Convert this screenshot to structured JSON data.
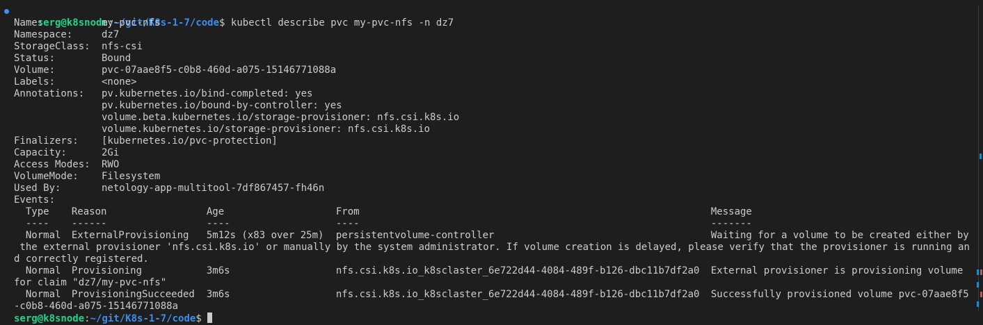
{
  "prompt": {
    "user_host": "serg@k8snode",
    "path": "~/git/K8s-1-7/code",
    "symbol": "$",
    "command": "kubectl describe pvc my-pvc-nfs -n dz7"
  },
  "fields": [
    {
      "key": "Name:",
      "value": "my-pvc-nfs"
    },
    {
      "key": "Namespace:",
      "value": "dz7"
    },
    {
      "key": "StorageClass:",
      "value": "nfs-csi"
    },
    {
      "key": "Status:",
      "value": "Bound"
    },
    {
      "key": "Volume:",
      "value": "pvc-07aae8f5-c0b8-460d-a075-15146771088a"
    },
    {
      "key": "Labels:",
      "value": "<none>"
    },
    {
      "key": "Annotations:",
      "value": "pv.kubernetes.io/bind-completed: yes"
    },
    {
      "key": "",
      "value": "pv.kubernetes.io/bound-by-controller: yes"
    },
    {
      "key": "",
      "value": "volume.beta.kubernetes.io/storage-provisioner: nfs.csi.k8s.io"
    },
    {
      "key": "",
      "value": "volume.kubernetes.io/storage-provisioner: nfs.csi.k8s.io"
    },
    {
      "key": "Finalizers:",
      "value": "[kubernetes.io/pvc-protection]"
    },
    {
      "key": "Capacity:",
      "value": "2Gi"
    },
    {
      "key": "Access Modes:",
      "value": "RWO"
    },
    {
      "key": "VolumeMode:",
      "value": "Filesystem"
    },
    {
      "key": "Used By:",
      "value": "netology-app-multitool-7df867457-fh46n"
    },
    {
      "key": "Events:",
      "value": ""
    }
  ],
  "events": {
    "headers": {
      "type": "Type",
      "reason": "Reason",
      "age": "Age",
      "from": "From",
      "message": "Message"
    },
    "dashes": {
      "type": "----",
      "reason": "------",
      "age": "----",
      "from": "----",
      "message": "-------"
    },
    "rows": [
      {
        "type": "Normal",
        "reason": "ExternalProvisioning",
        "age": "5m12s (x83 over 25m)",
        "from": "persistentvolume-controller",
        "message": "Waiting for a volume to be created either by",
        "wrap": [
          " the external provisioner 'nfs.csi.k8s.io' or manually by the system administrator. If volume creation is delayed, please verify that the provisioner is running an",
          "d correctly registered."
        ]
      },
      {
        "type": "Normal",
        "reason": "Provisioning",
        "age": "3m6s",
        "from": "nfs.csi.k8s.io_k8sclaster_6e722d44-4084-489f-b126-dbc11b7df2a0",
        "message": "External provisioner is provisioning volume",
        "wrap": [
          "for claim \"dz7/my-pvc-nfs\""
        ]
      },
      {
        "type": "Normal",
        "reason": "ProvisioningSucceeded",
        "age": "3m6s",
        "from": "nfs.csi.k8s.io_k8sclaster_6e722d44-4084-489f-b126-dbc11b7df2a0",
        "message": "Successfully provisioned volume pvc-07aae8f5",
        "wrap": [
          "-c0b8-460d-a075-15146771088a"
        ]
      }
    ]
  },
  "colors": {
    "background": "#1e1e1e",
    "text": "#cccccc",
    "user_host": "#23d18b",
    "path": "#3b8eea",
    "command_marker": "#3794ff",
    "scroll_marker_blue": "#2188c7",
    "scroll_marker_red": "#d94b4b"
  }
}
